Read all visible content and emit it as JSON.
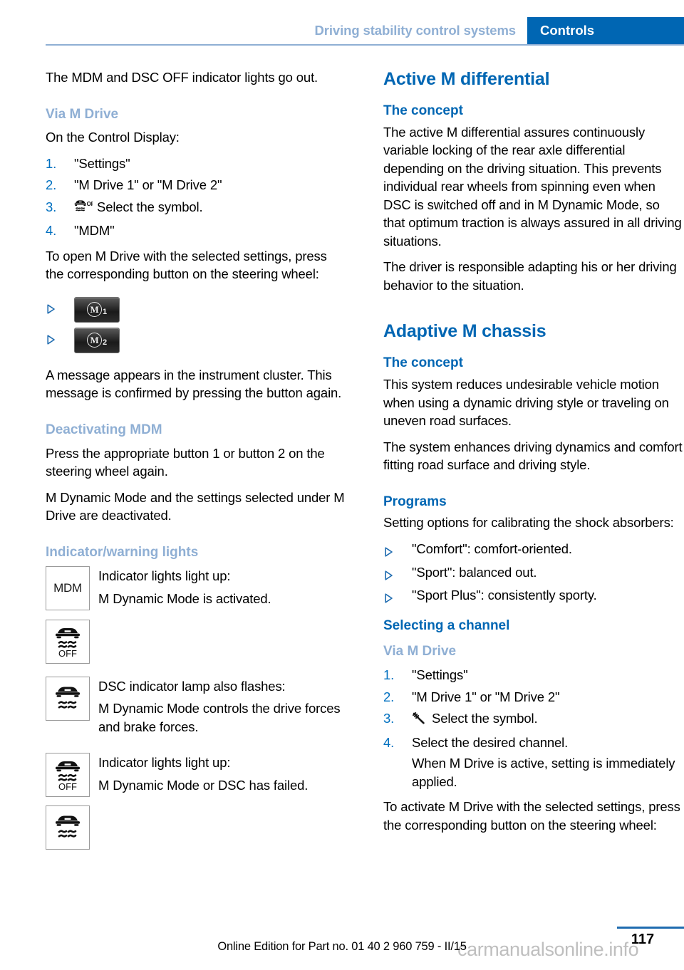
{
  "header": {
    "chapter": "Driving stability control systems",
    "section": "Controls"
  },
  "left_column": {
    "intro": "The MDM and DSC OFF indicator lights go out.",
    "via_m_drive_heading": "Via M Drive",
    "control_display_lead": "On the Control Display:",
    "steps": [
      "\"Settings\"",
      "\"M Drive 1\" or \"M Drive 2\"",
      "Select the symbol.",
      "\"MDM\""
    ],
    "open_m_drive": "To open M Drive with the selected settings, press the corresponding button on the steering wheel:",
    "m_buttons": [
      {
        "label": "M",
        "sub": "1"
      },
      {
        "label": "M",
        "sub": "2"
      }
    ],
    "message_paragraph": "A message appears in the instrument cluster. This message is confirmed by pressing the button again.",
    "deactivating_heading": "Deactivating MDM",
    "deactivating_p1": "Press the appropriate button 1 or button 2 on the steering wheel again.",
    "deactivating_p2": "M Dynamic Mode and the settings selected under M Drive are deactivated.",
    "indicator_heading": "Indicator/warning lights",
    "indicator_rows": [
      {
        "icon": "mdm-text-icon",
        "icon_label": "MDM",
        "lines": [
          "Indicator lights light up:",
          "M Dynamic Mode is activated."
        ]
      },
      {
        "icon": "dsc-off-icon",
        "icon_label": "OFF",
        "lines": []
      },
      {
        "icon": "dsc-icon",
        "icon_label": "",
        "lines": [
          "DSC indicator lamp also flashes:",
          "M Dynamic Mode controls the drive forces and brake forces."
        ]
      },
      {
        "icon": "dsc-off-icon",
        "icon_label": "OFF",
        "lines": [
          "Indicator lights light up:",
          "M Dynamic Mode or DSC has failed."
        ]
      },
      {
        "icon": "dsc-icon",
        "icon_label": "",
        "lines": []
      }
    ]
  },
  "right_column": {
    "active_diff_title": "Active M differential",
    "active_diff_concept_heading": "The concept",
    "active_diff_p1": "The active M differential assures continuously variable locking of the rear axle differential depending on the driving situation. This prevents individual rear wheels from spinning even when DSC is switched off and in M Dynamic Mode, so that optimum traction is always assured in all driving situations.",
    "active_diff_p2": "The driver is responsible adapting his or her driving behavior to the situation.",
    "adaptive_title": "Adaptive M chassis",
    "adaptive_concept_heading": "The concept",
    "adaptive_p1": "This system reduces undesirable vehicle motion when using a dynamic driving style or traveling on uneven road surfaces.",
    "adaptive_p2": "The system enhances driving dynamics and comfort fitting road surface and driving style.",
    "programs_heading": "Programs",
    "programs_lead": "Setting options for calibrating the shock absorbers:",
    "programs": [
      "\"Comfort\": comfort-oriented.",
      "\"Sport\": balanced out.",
      "\"Sport Plus\": consistently sporty."
    ],
    "selecting_heading": "Selecting a channel",
    "via_m_drive_heading": "Via M Drive",
    "steps": [
      "\"Settings\"",
      "\"M Drive 1\" or \"M Drive 2\"",
      "Select the symbol.",
      "Select the desired channel."
    ],
    "step4_note": "When M Drive is active, setting is immediately applied.",
    "activate_m_drive": "To activate M Drive with the selected settings, press the corresponding button on the steering wheel:"
  },
  "footer": {
    "edition_text": "Online Edition for Part no. 01 40 2 960 759 - II/15",
    "watermark": "carmanualsonline.info",
    "page_number": "117"
  },
  "colors": {
    "heading_blue": "#0066b3",
    "light_blue": "#8fafd4",
    "list_number_blue": "#0070c0",
    "header_bg": "#0066b3"
  }
}
